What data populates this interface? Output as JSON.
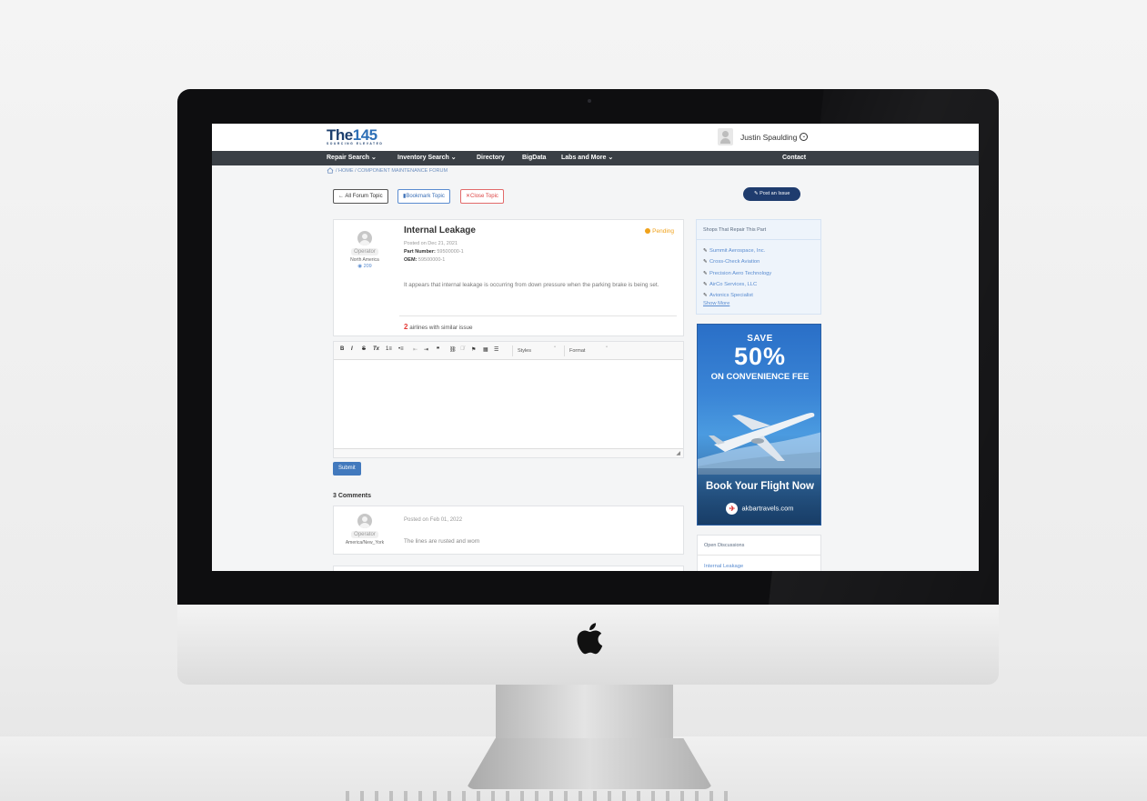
{
  "brand": {
    "name_a": "The",
    "name_b": "145",
    "tagline": "SOURCING ELEVATED"
  },
  "user": {
    "name": "Justin Spaulding"
  },
  "nav": {
    "items": [
      "Repair Search ⌄",
      "Inventory Search ⌄",
      "Directory",
      "BigData",
      "Labs and More ⌄"
    ],
    "contact": "Contact"
  },
  "breadcrumb": "/ HOME / COMPONENT MAINTENANCE FORUM",
  "actions": {
    "all_topics": "All Forum Topic",
    "bookmark": "Bookmark Topic",
    "close": "Close Topic",
    "post": "Post an Issue"
  },
  "topic": {
    "title": "Internal Leakage",
    "status": "Pending",
    "posted": "Posted on Dec 21, 2021",
    "part_label": "Part Number:",
    "part_value": "59500000-1",
    "oem_label": "OEM:",
    "oem_value": "59500000-1",
    "body": "It appears that internal leakage is occurring from down pressure when the parking brake is being set.",
    "similar_count": "2",
    "similar_text": "airlines with similar issue",
    "author": {
      "role": "Operator",
      "region": "North America",
      "views": "209"
    }
  },
  "editor": {
    "tools": [
      "B",
      "I",
      "S",
      "Tx",
      "1≡",
      "•≡",
      "⇤",
      "⇥",
      "❞",
      "⛓",
      "⛓̸",
      "⚑",
      "▦",
      "☰"
    ],
    "styles_label": "Styles",
    "format_label": "Format"
  },
  "submit_label": "Submit",
  "comments": {
    "heading": "3 Comments",
    "items": [
      {
        "role": "Operator",
        "region": "America/New_York",
        "posted": "Posted on Feb 01, 2022",
        "text": "The lines are rusted and worn"
      }
    ]
  },
  "shops": {
    "heading": "Shops That Repair This Part",
    "items": [
      "Summit Aerospace, Inc.",
      "Cross-Check Aviation",
      "Precision Aero Technology",
      "AirCo Services, LLC",
      "Avionics Specialist"
    ],
    "show_more": "Show More"
  },
  "ad": {
    "save": "SAVE",
    "percent": "50%",
    "line": "ON CONVENIENCE FEE",
    "cta": "Book Your Flight Now",
    "site": "akbartravels.com"
  },
  "open_discussions": {
    "heading": "Open Discussions",
    "items": [
      "Internal Leakage"
    ]
  },
  "colors": {
    "navbar": "#3a3f45",
    "pending": "#f0a21b",
    "primary": "#1f3c6e",
    "link": "#5a8cd0"
  }
}
